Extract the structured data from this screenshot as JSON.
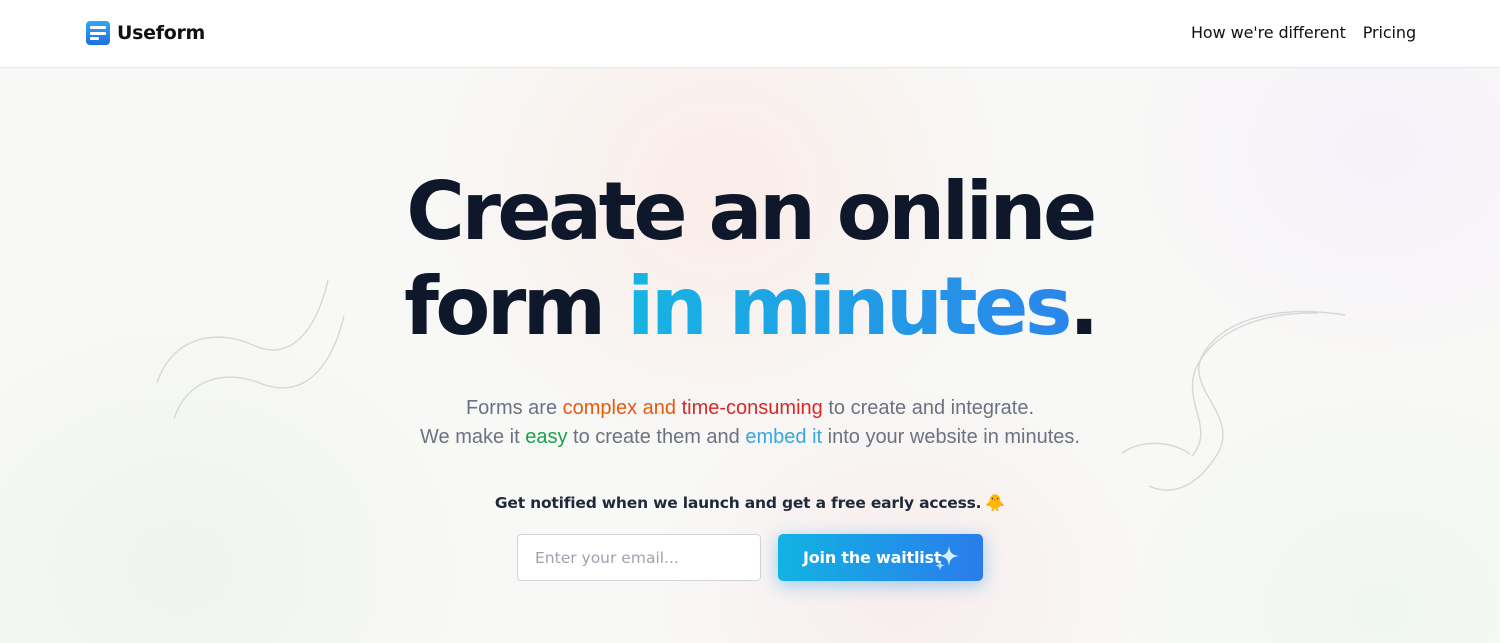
{
  "header": {
    "brand_name": "Useform",
    "brand_icon": "form-logo-icon",
    "nav": [
      {
        "label": "How we're different"
      },
      {
        "label": "Pricing"
      }
    ]
  },
  "hero": {
    "headline_line1": "Create an online",
    "headline_line2_prefix": "form ",
    "headline_line2_accent": "in minutes",
    "headline_line2_suffix": ".",
    "sub_line1": {
      "before": "Forms are ",
      "orange": "complex and ",
      "red": "time-consuming",
      "after": " to create and integrate."
    },
    "sub_line2": {
      "before": "We make it ",
      "green": "easy",
      "mid": " to create them and ",
      "blue": "embed it",
      "after": " into your website in minutes."
    },
    "notify_text": "Get notified when we launch and get a free early access.",
    "notify_emoji": "🐥",
    "email_placeholder": "Enter your email...",
    "email_value": "",
    "cta_label": "Join the waitlist",
    "cta_icon": "sparkle-icon"
  },
  "colors": {
    "accent_start": "#11b3e3",
    "accent_end": "#2b7ceb",
    "headline": "#0f172a",
    "orange": "#e8590c",
    "red": "#dc2626",
    "green": "#16a34a",
    "blue": "#38a6e0"
  }
}
